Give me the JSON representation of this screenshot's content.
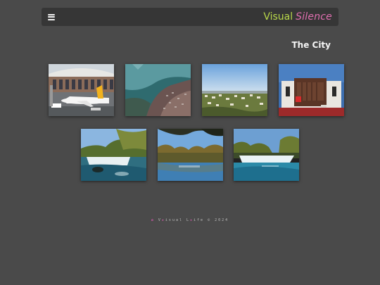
{
  "colors": {
    "background": "#4a4a4a",
    "navbar": "#363636",
    "brand_primary": "#b9d84a",
    "brand_secondary": "#e06fb0",
    "title": "#f4f4f4",
    "footer_star": "#e05ab4"
  },
  "navbar": {
    "menu_icon": "hamburger-menu-icon",
    "brand_word1": "Visual",
    "brand_word2": "Silence"
  },
  "page": {
    "title": "The City"
  },
  "gallery": [
    {
      "subject": "airport-airplane"
    },
    {
      "subject": "aerial-coastline"
    },
    {
      "subject": "city-panorama"
    },
    {
      "subject": "wooden-box-house"
    },
    {
      "subject": "waterfall-forest"
    },
    {
      "subject": "river-trees"
    },
    {
      "subject": "waterfall-wide"
    }
  ],
  "footer": {
    "star_icon": "star-icon",
    "word1": "V",
    "word1_rest": "isual",
    "word2": "L",
    "word2_rest": "ife",
    "copyright": "© 2024"
  }
}
